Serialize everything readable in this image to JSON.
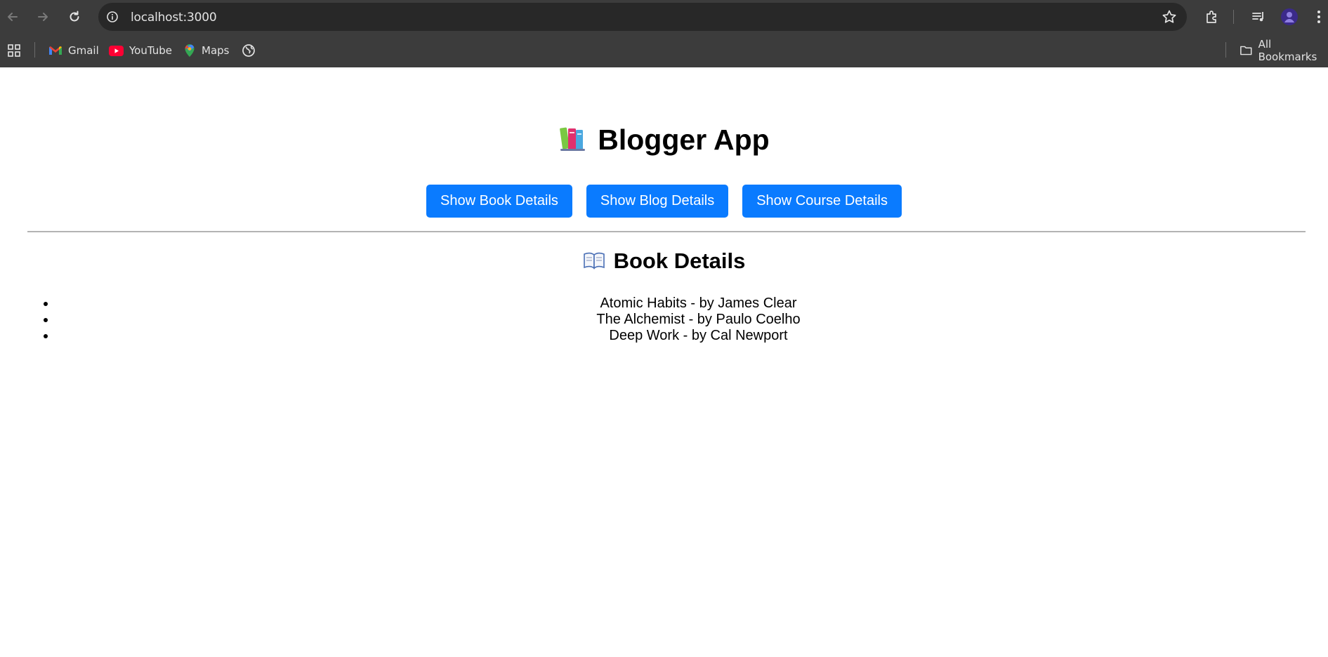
{
  "browser": {
    "url": "localhost:3000",
    "bookmarks": [
      {
        "label": "Gmail",
        "icon": "gmail-icon"
      },
      {
        "label": "YouTube",
        "icon": "youtube-icon"
      },
      {
        "label": "Maps",
        "icon": "maps-icon"
      }
    ],
    "all_bookmarks_label": "All Bookmarks"
  },
  "app": {
    "title": "Blogger App",
    "title_icon": "books-icon",
    "buttons": {
      "book": "Show Book Details",
      "blog": "Show Blog Details",
      "course": "Show Course Details"
    },
    "button_color": "#0a7bff",
    "section": {
      "title": "Book Details",
      "icon": "open-book-icon",
      "items": [
        "Atomic Habits - by James Clear",
        "The Alchemist - by Paulo Coelho",
        "Deep Work - by Cal Newport"
      ]
    }
  }
}
